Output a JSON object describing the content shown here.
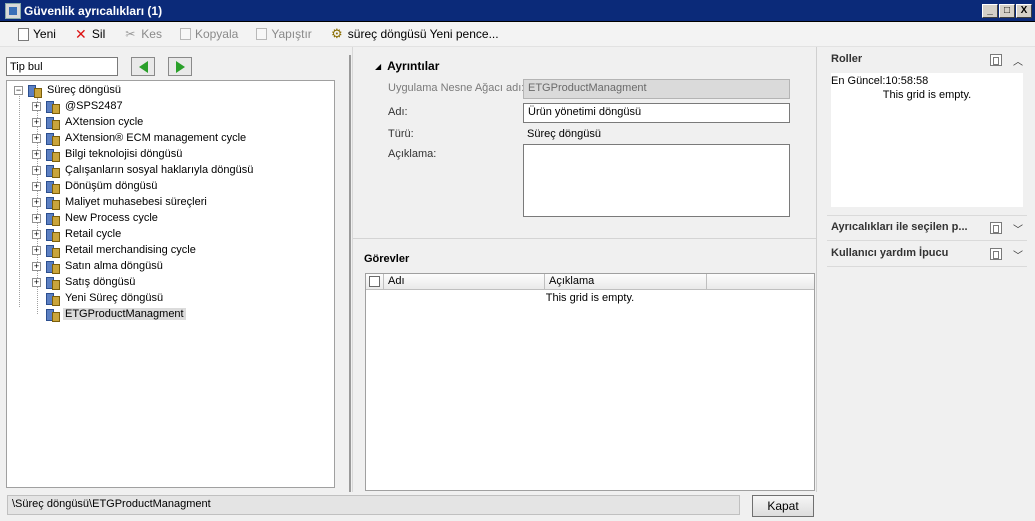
{
  "window": {
    "title": "Güvenlik ayrıcalıkları (1)",
    "buttons": [
      "_",
      "□",
      "X"
    ]
  },
  "toolbar": {
    "new_label": "Yeni",
    "delete_label": "Sil",
    "cut_label": "Kes",
    "copy_label": "Kopyala",
    "paste_label": "Yapıştır",
    "newwin_label": "süreç döngüsü Yeni pence..."
  },
  "search": {
    "value": "Tip bul"
  },
  "tree": {
    "root": "Süreç döngüsü",
    "items": [
      "@SPS2487",
      "AXtension cycle",
      "AXtension® ECM management cycle",
      "Bilgi teknolojisi döngüsü",
      "Çalışanların sosyal haklarıyla döngüsü",
      "Dönüşüm döngüsü",
      "Maliyet muhasebesi süreçleri",
      "New Process cycle",
      "Retail cycle",
      "Retail merchandising cycle",
      "Satın alma döngüsü",
      "Satış döngüsü",
      "Yeni Süreç döngüsü",
      "ETGProductManagment"
    ]
  },
  "details": {
    "title": "Ayrıntılar",
    "aot_label": "Uygulama Nesne Ağacı adı:",
    "aot_value": "ETGProductManagment",
    "name_label": "Adı:",
    "name_value": "Ürün yönetimi döngüsü",
    "type_label": "Türü:",
    "type_value": "Süreç döngüsü",
    "desc_label": "Açıklama:"
  },
  "tasks": {
    "title": "Görevler",
    "columns": [
      "Adı",
      "Açıklama"
    ],
    "empty": "This grid is empty."
  },
  "right": {
    "roles_title": "Roller",
    "roles_updated": "En Güncel:10:58:58",
    "roles_empty": "This grid is empty.",
    "privileges_title": "Ayrıcalıkları ile seçilen p...",
    "help_title": "Kullanıcı yardım İpucu"
  },
  "status": {
    "path": "\\Süreç döngüsü\\ETGProductManagment",
    "close_label": "Kapat"
  }
}
